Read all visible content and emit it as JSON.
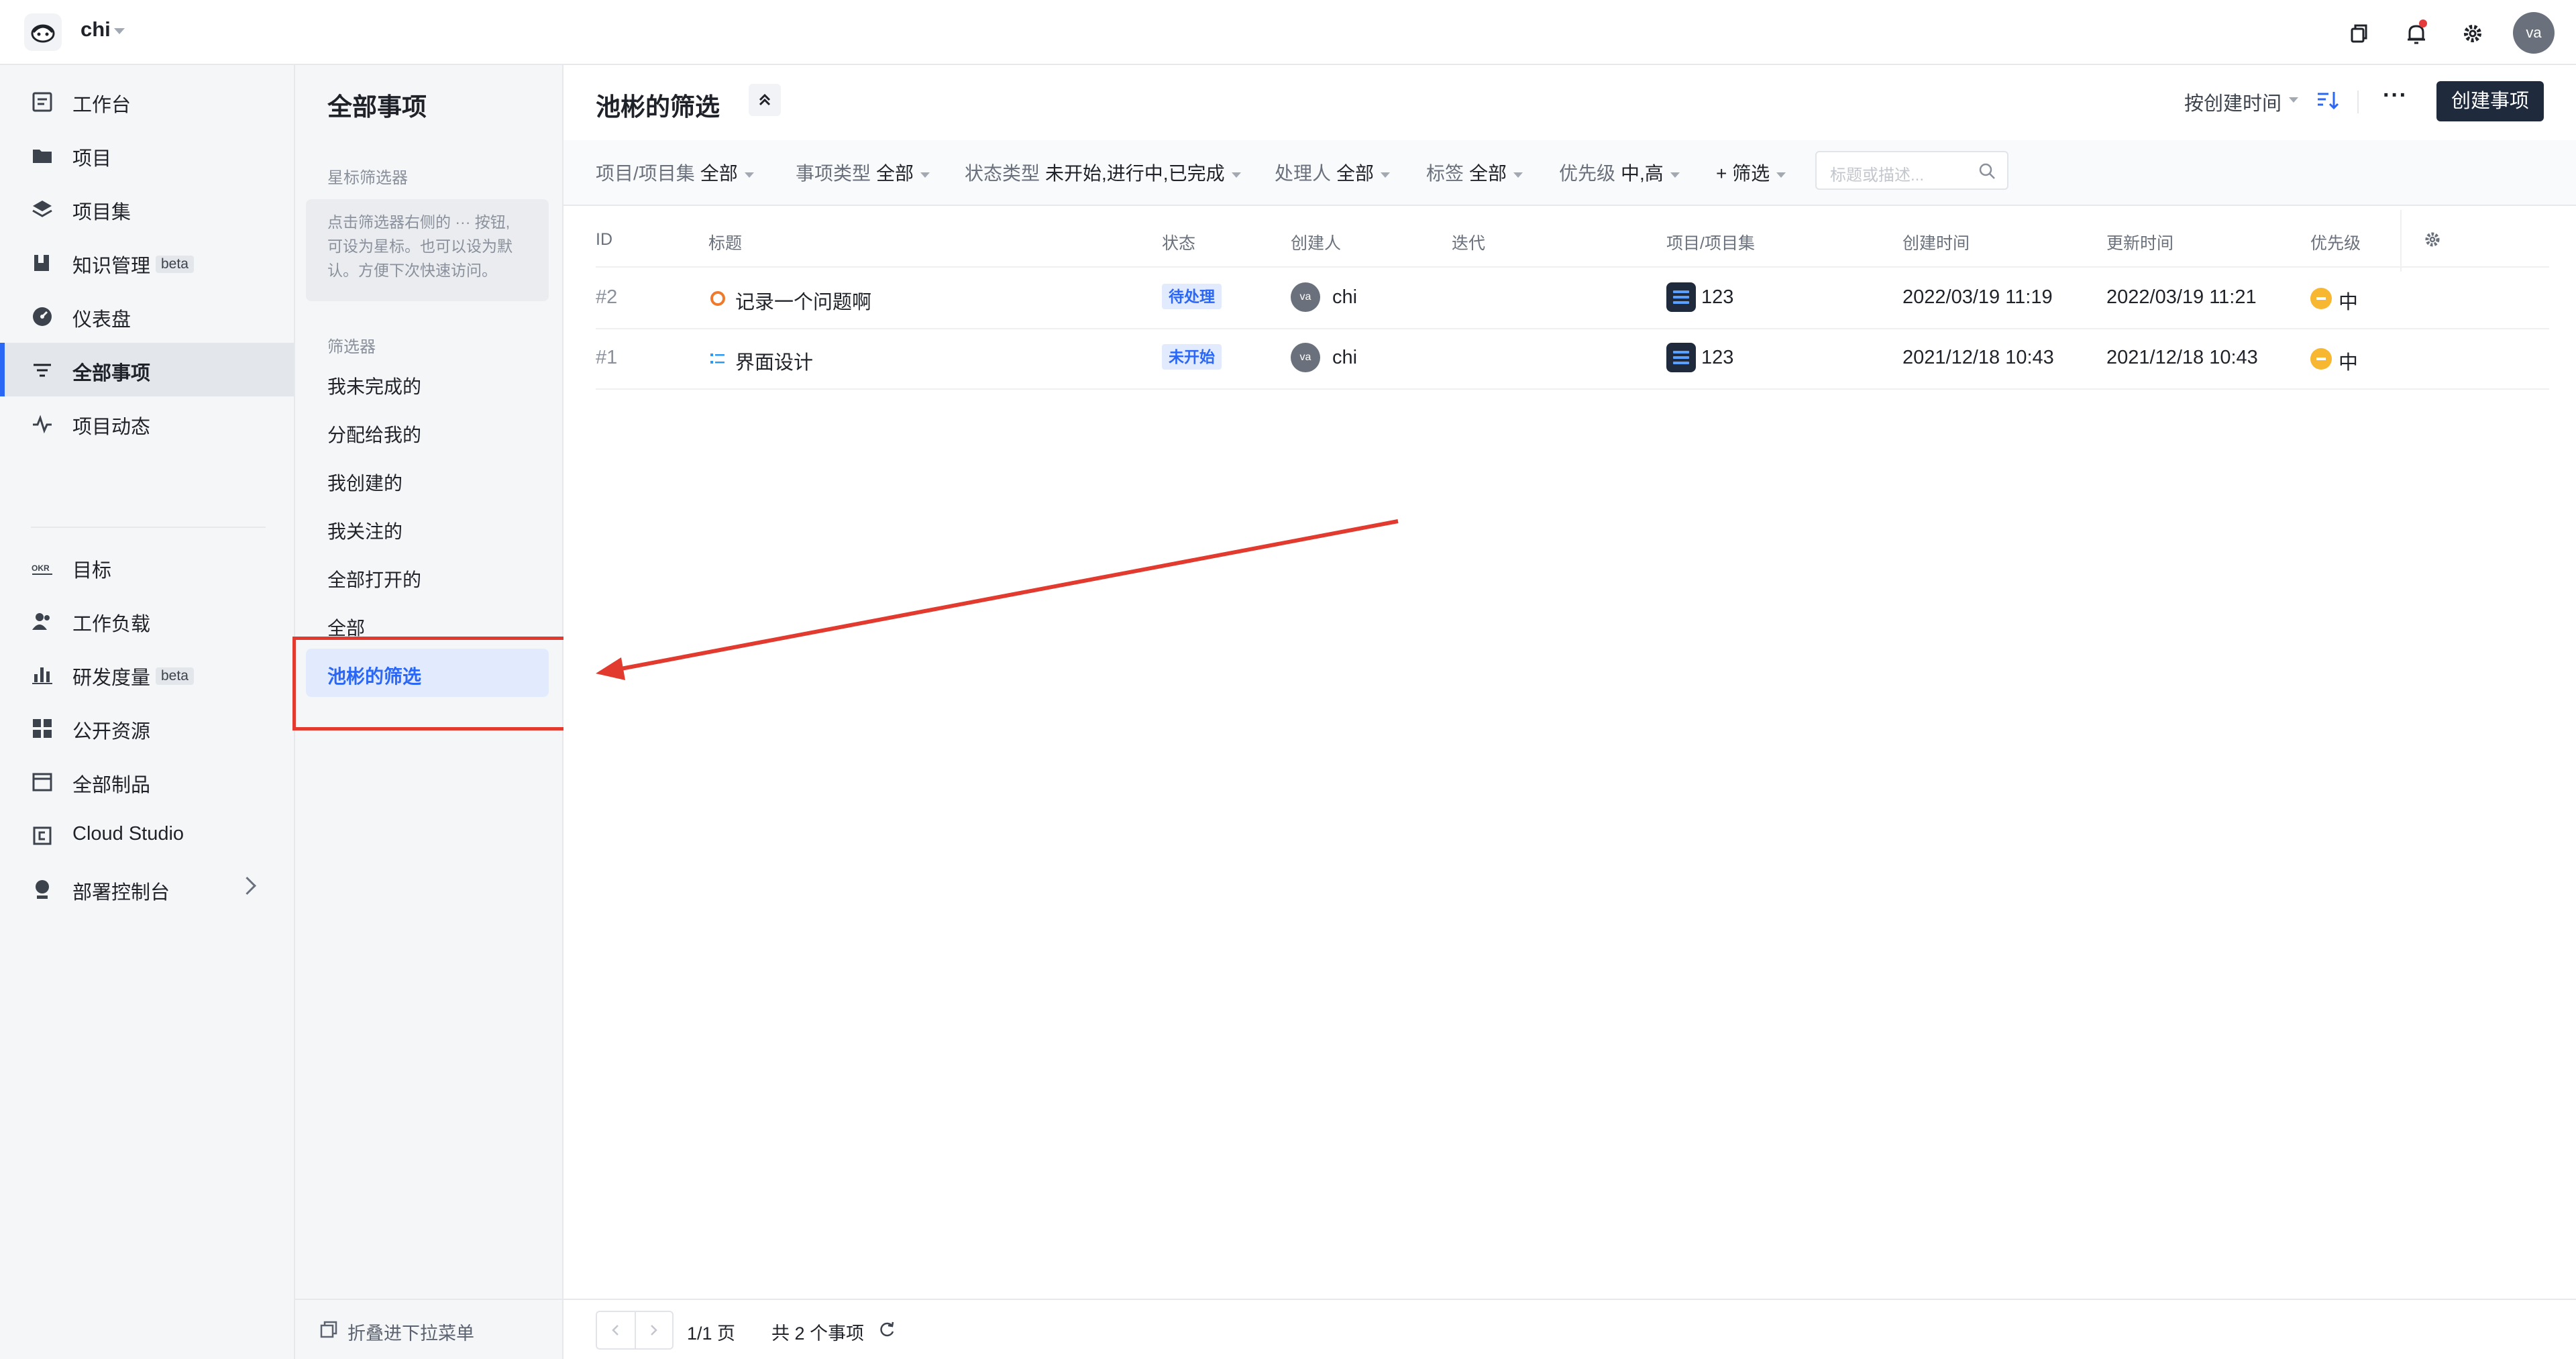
{
  "topbar": {
    "team_name": "chi",
    "user_initials": "va",
    "icons": [
      "copy-icon",
      "bell-icon",
      "gear-icon"
    ]
  },
  "sidebar": {
    "items": [
      {
        "label": "工作台",
        "icon": "workbench-icon",
        "active": false
      },
      {
        "label": "项目",
        "icon": "folder-icon",
        "active": false
      },
      {
        "label": "项目集",
        "icon": "layers-icon",
        "active": false
      },
      {
        "label": "知识管理",
        "icon": "book-icon",
        "active": false,
        "badge": "beta"
      },
      {
        "label": "仪表盘",
        "icon": "dashboard-icon",
        "active": false
      },
      {
        "label": "全部事项",
        "icon": "filter-lines-icon",
        "active": true
      },
      {
        "label": "项目动态",
        "icon": "pulse-icon",
        "active": false
      },
      {
        "label": "目标",
        "icon": "okr-icon",
        "active": false
      },
      {
        "label": "工作负载",
        "icon": "users-icon",
        "active": false
      },
      {
        "label": "研发度量",
        "icon": "bar-chart-icon",
        "active": false,
        "badge": "beta"
      },
      {
        "label": "公开资源",
        "icon": "grid-icon",
        "active": false
      },
      {
        "label": "全部制品",
        "icon": "box-icon",
        "active": false
      },
      {
        "label": "Cloud Studio",
        "icon": "cloud-studio-icon",
        "active": false
      },
      {
        "label": "部署控制台",
        "icon": "deploy-icon",
        "active": false,
        "has_submenu": true
      }
    ]
  },
  "filter_panel": {
    "title": "全部事项",
    "starred_section": "星标筛选器",
    "starred_tip_lines": [
      "点击筛选器右侧的 ··· 按钮,",
      "可设为星标。也可以设为默",
      "认。方便下次快速访问。"
    ],
    "filters_section": "筛选器",
    "filters": [
      "我未完成的",
      "分配给我的",
      "我创建的",
      "我关注的",
      "全部打开的",
      "全部"
    ],
    "selected_filter": "池彬的筛选",
    "collapse_label": "折叠进下拉菜单"
  },
  "main": {
    "title": "池彬的筛选",
    "sort_label": "按创建时间",
    "create_button": "创建事项",
    "filter_bar": [
      {
        "key": "项目/项目集",
        "value": "全部"
      },
      {
        "key": "事项类型",
        "value": "全部"
      },
      {
        "key": "状态类型",
        "value": "未开始,进行中,已完成"
      },
      {
        "key": "处理人",
        "value": "全部"
      },
      {
        "key": "标签",
        "value": "全部"
      },
      {
        "key": "优先级",
        "value": "中,高"
      },
      {
        "key": "+ 筛选",
        "value": ""
      }
    ],
    "search_placeholder": "标题或描述...",
    "columns": [
      "ID",
      "标题",
      "状态",
      "创建人",
      "迭代",
      "项目/项目集",
      "创建时间",
      "更新时间",
      "优先级"
    ],
    "rows": [
      {
        "id": "#2",
        "type_icon": "defect-icon",
        "title": "记录一个问题啊",
        "status": "待处理",
        "creator_initials": "va",
        "creator": "chi",
        "iteration": "",
        "project": "123",
        "created": "2022/03/19 11:19",
        "updated": "2022/03/19 11:21",
        "priority": "中"
      },
      {
        "id": "#1",
        "type_icon": "requirement-icon",
        "title": "界面设计",
        "status": "未开始",
        "creator_initials": "va",
        "creator": "chi",
        "iteration": "",
        "project": "123",
        "created": "2021/12/18 10:43",
        "updated": "2021/12/18 10:43",
        "priority": "中"
      }
    ],
    "pagination": {
      "page": "1/1 页",
      "total": "共 2 个事项"
    }
  },
  "colors": {
    "accent": "#2b67f6",
    "annotation": "#e23a2e",
    "dark_button": "#1f2b3d",
    "priority_medium": "#f7b731"
  }
}
